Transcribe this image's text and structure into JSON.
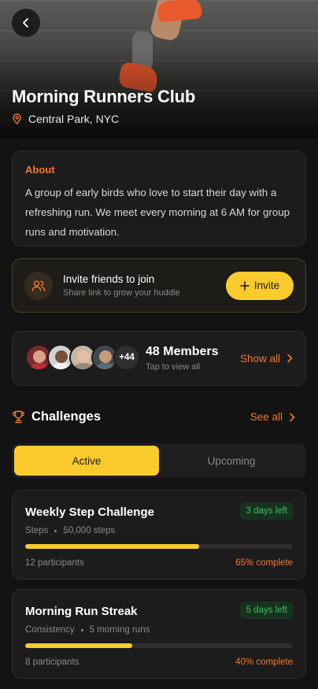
{
  "club": {
    "name": "Morning Runners Club",
    "location": "Central Park, NYC"
  },
  "about": {
    "heading": "About",
    "text": "A group of early birds who love to start their day with a refreshing run. We meet every morning at 6 AM for group runs and motivation."
  },
  "invite": {
    "title": "Invite friends to join",
    "subtitle": "Share link to grow your huddle",
    "button_label": "Invite"
  },
  "members": {
    "count_label": "48 Members",
    "subtitle": "Tap to view all",
    "more_badge": "+44",
    "show_all_label": "Show all"
  },
  "challenges": {
    "heading": "Challenges",
    "see_all_label": "See all",
    "tabs": [
      {
        "label": "Active",
        "active": true
      },
      {
        "label": "Upcoming",
        "active": false
      }
    ],
    "items": [
      {
        "name": "Weekly Step Challenge",
        "badge": "3 days left",
        "category": "Steps",
        "goal": "50,000 steps",
        "progress": 0.65,
        "participants": "12 participants",
        "complete": "65% complete"
      },
      {
        "name": "Morning Run Streak",
        "badge": "5 days left",
        "category": "Consistency",
        "goal": "5 morning runs",
        "progress": 0.4,
        "participants": "8 participants",
        "complete": "40% complete"
      }
    ]
  },
  "colors": {
    "accent_yellow": "#fbcb2d",
    "accent_orange": "#f0772c",
    "badge_green": "#3fbf5f",
    "background": "#131313"
  },
  "icons": [
    "chevron-left-icon",
    "location-pin-icon",
    "users-icon",
    "plus-icon",
    "chevron-right-icon",
    "trophy-icon"
  ]
}
